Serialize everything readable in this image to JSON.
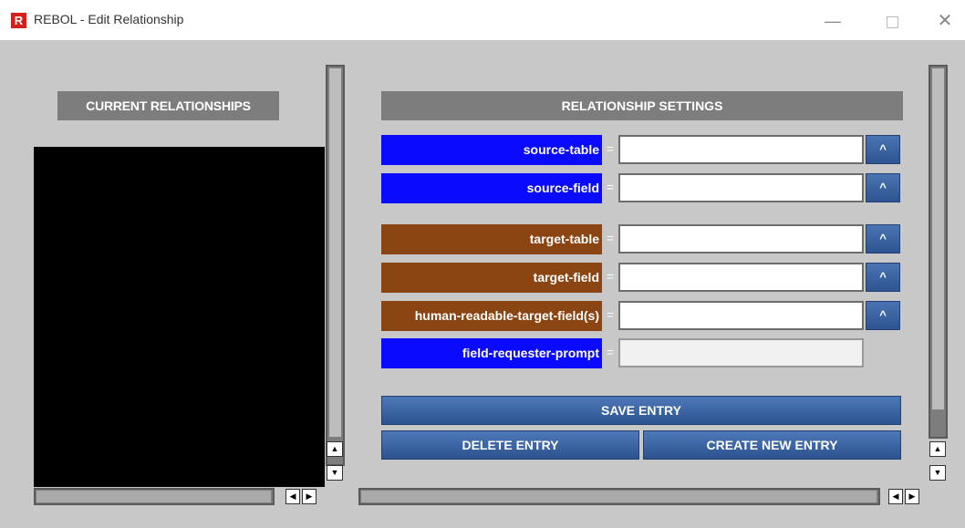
{
  "window": {
    "app_icon_letter": "R",
    "title": "REBOL - Edit Relationship",
    "minimize_glyph": "—",
    "close_glyph": "✕"
  },
  "left_panel": {
    "header": "CURRENT RELATIONSHIPS",
    "list_items": []
  },
  "right_panel": {
    "header": "RELATIONSHIP SETTINGS",
    "equals": "=",
    "caret": "^",
    "rows": [
      {
        "label": "source-table",
        "value": "",
        "color": "#0a0aff"
      },
      {
        "label": "source-field",
        "value": "",
        "color": "#0a0aff"
      },
      {
        "label": "target-table",
        "value": "",
        "color": "#8b4513"
      },
      {
        "label": "target-field",
        "value": "",
        "color": "#8b4513"
      },
      {
        "label": "human-readable-target-field(s)",
        "value": "",
        "color": "#8b4513"
      },
      {
        "label": "field-requester-prompt",
        "value": "",
        "color": "#0a0aff"
      }
    ],
    "save_label": "SAVE ENTRY",
    "delete_label": "DELETE ENTRY",
    "create_label": "CREATE NEW ENTRY"
  },
  "scroll": {
    "up_glyph": "▲",
    "down_glyph": "▼",
    "left_glyph": "◀",
    "right_glyph": "▶"
  }
}
